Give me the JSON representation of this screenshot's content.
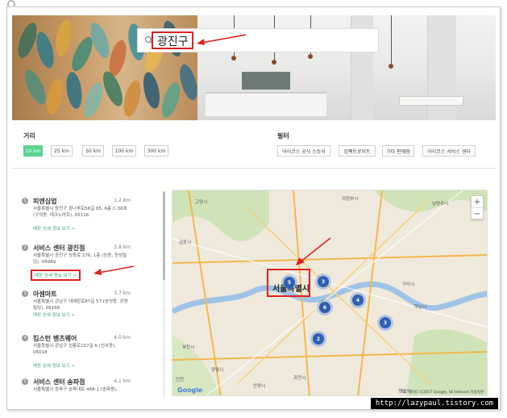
{
  "search": {
    "value": "광진구"
  },
  "filters": {
    "distance_label": "거리",
    "distances": [
      "10 km",
      "25 km",
      "50 km",
      "100 km",
      "300 km"
    ],
    "active_distance": "10 km",
    "filter_label": "필터",
    "types": [
      "아이코스 공식 스토어",
      "임팩트로미트",
      "기타 판매점",
      "아이코스 서비스 센터"
    ]
  },
  "stores": [
    {
      "num": "1",
      "name": "피엔심업",
      "dist": "1.2 km",
      "address": "서울특별시 광진구 광나루로56길 85, 6층 C-36호 (구의동, 테크노마트), 05116",
      "link": "매장 상세 정보 보기 >"
    },
    {
      "num": "2",
      "name": "서비스 센터 광진점",
      "dist": "1.8 km",
      "address": "서울특별시 광진구 능동로 276, 1층 (능동, 한성빌딩), 04989",
      "link": "매장 상세 정보 보기 >"
    },
    {
      "num": "3",
      "name": "아셈마트",
      "dist": "3.7 km",
      "address": "서울특별시 강남구 테헤란로87길 57 (삼성동, 강영빌딩), 06166",
      "link": "매장 상세 정보 보기 >"
    },
    {
      "num": "4",
      "name": "킴스턴 벤츠웨어",
      "dist": "4.0 km",
      "address": "서울특별시 강남구 선릉로157길 6 (신사동), 06018",
      "link": "매장 상세 정보 보기 >"
    },
    {
      "num": "5",
      "name": "서비스 센터 송파점",
      "dist": "4.1 km",
      "address": "서울특별시 송파구 송파대로 448-1 (송파동),",
      "link": ""
    }
  ],
  "map": {
    "city_label": "서울특별시",
    "clusters": [
      "5",
      "3",
      "6",
      "4",
      "3",
      "2"
    ],
    "towns": [
      "고양시",
      "남양주시",
      "의정부시",
      "구리시",
      "하남시",
      "성남시",
      "과천시",
      "광명시",
      "부천시",
      "김포시",
      "인천",
      "안양시",
      "서울"
    ],
    "logo": "Google",
    "attribution": "지도 데이터 ©2017 Google, SK telecom 이용약관",
    "zoom_in": "+",
    "zoom_out": "−"
  },
  "watermark": "http://lazypaul.tistory.com",
  "colors": {
    "accent": "#5bd28f",
    "link": "#3aa672",
    "cluster": "#2f5fb3",
    "annotation": "#e02020"
  }
}
